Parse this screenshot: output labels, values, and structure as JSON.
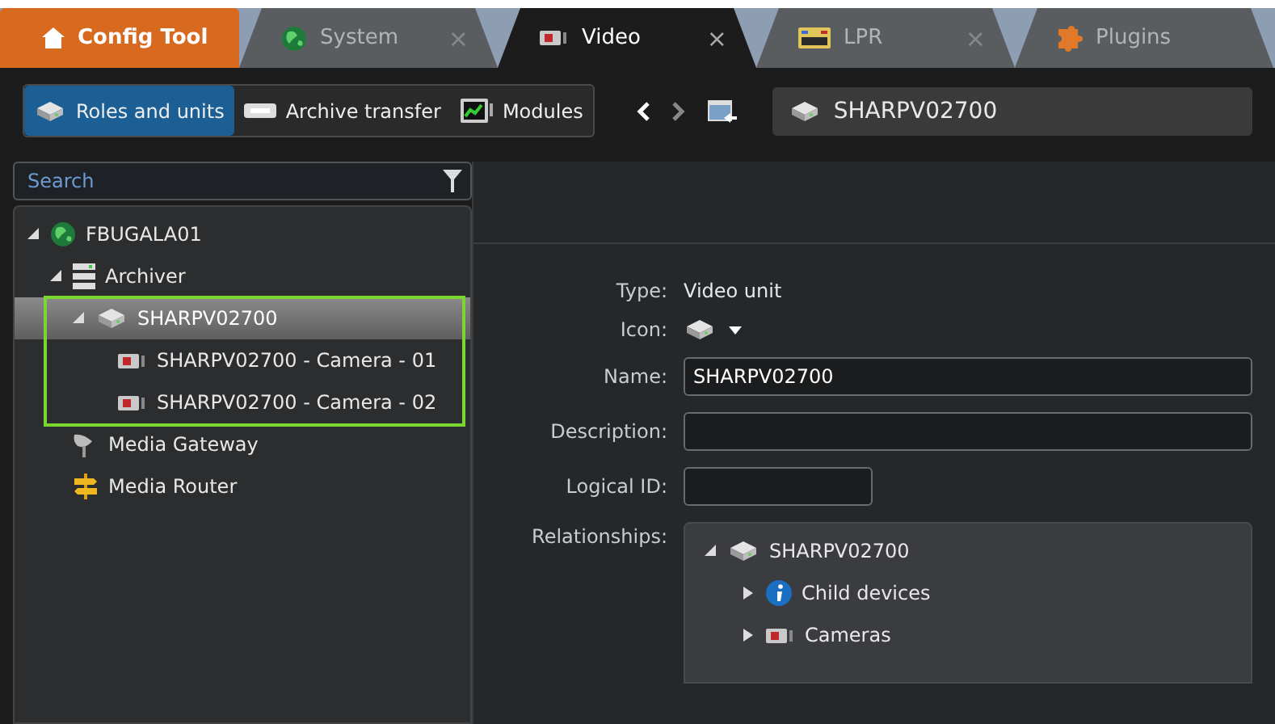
{
  "tabs": [
    {
      "kind": "home",
      "label": "Config Tool",
      "selected": false
    },
    {
      "kind": "globe",
      "label": "System",
      "close": "×",
      "selected": false
    },
    {
      "kind": "camera",
      "label": "Video",
      "close": "×",
      "selected": true
    },
    {
      "kind": "plate",
      "label": "LPR",
      "close": "×",
      "selected": false
    },
    {
      "kind": "puzzle",
      "label": "Plugins",
      "selected": false
    }
  ],
  "toolbar": {
    "segments": [
      {
        "kind": "unit",
        "label": "Roles and units",
        "selected": true
      },
      {
        "kind": "transfer",
        "label": "Archive transfer",
        "selected": false
      },
      {
        "kind": "monitor",
        "label": "Modules",
        "selected": false
      }
    ],
    "address": "SHARPV02700"
  },
  "search": {
    "placeholder": "Search"
  },
  "tree": [
    {
      "kind": "globe",
      "label": "FBUGALA01",
      "expanded": true,
      "selected": false,
      "children": [
        {
          "kind": "archiver",
          "label": "Archiver",
          "expanded": true,
          "selected": false,
          "children": [
            {
              "kind": "unit",
              "label": "SHARPV02700",
              "expanded": true,
              "selected": true,
              "highlighted": true,
              "children": [
                {
                  "kind": "camera",
                  "label": "SHARPV02700 - Camera - 01",
                  "selected": false
                },
                {
                  "kind": "camera",
                  "label": "SHARPV02700 - Camera - 02",
                  "selected": false
                }
              ]
            }
          ]
        },
        {
          "kind": "gateway",
          "label": "Media Gateway",
          "selected": false
        },
        {
          "kind": "router",
          "label": "Media Router",
          "selected": false
        }
      ]
    }
  ],
  "form": {
    "type_label": "Type:",
    "type_value": "Video unit",
    "icon_label": "Icon:",
    "name_label": "Name:",
    "name_value": "SHARPV02700",
    "description_label": "Description:",
    "logical_id_label": "Logical ID:",
    "relationships_label": "Relationships:",
    "relationships": [
      {
        "kind": "unit",
        "label": "SHARPV02700",
        "expanded": true,
        "children": [
          {
            "kind": "info",
            "label": "Child devices",
            "expanded": false
          },
          {
            "kind": "camera",
            "label": "Cameras",
            "expanded": false
          }
        ]
      }
    ]
  }
}
